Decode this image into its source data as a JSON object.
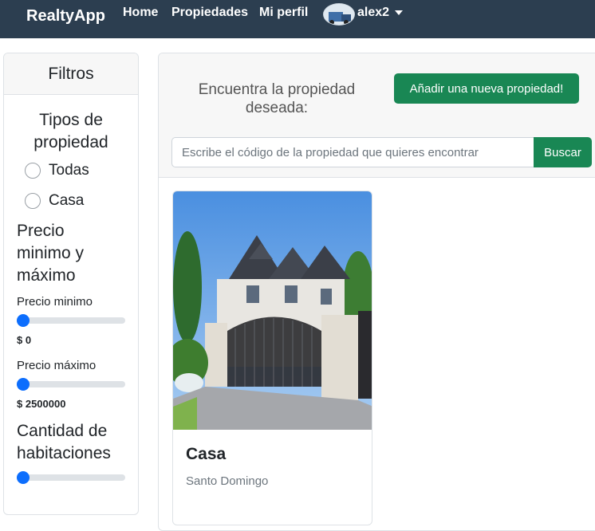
{
  "navbar": {
    "brand": "RealtyApp",
    "links": [
      "Home",
      "Propiedades",
      "Mi perfil"
    ],
    "username": "alex2",
    "avatar_icon": "user-avatar",
    "background": "#2c3e50"
  },
  "sidebar": {
    "header": "Filtros",
    "property_types_title_line1": "Tipos de",
    "property_types_title_line2": "propiedad",
    "property_types": [
      "Todas",
      "Casa"
    ],
    "price_title_line1": "Precio",
    "price_title_line2": "minimo y",
    "price_title_line3": "máximo",
    "min_price_label": "Precio minimo",
    "min_price_value": "$ 0",
    "max_price_label": "Precio máximo",
    "max_price_value": "$ 2500000",
    "rooms_title_line1": "Cantidad de",
    "rooms_title_line2": "habitaciones"
  },
  "main": {
    "headline_line1": "Encuentra la propiedad",
    "headline_line2": "deseada:",
    "add_button": "Añadir una nueva propiedad!",
    "search_placeholder": "Escribe el código de la propiedad que quieres encontrar",
    "search_button": "Buscar",
    "accent_color": "#198754"
  },
  "cards": [
    {
      "title": "Casa",
      "location": "Santo Domingo",
      "image_icon": "house-photo"
    }
  ]
}
